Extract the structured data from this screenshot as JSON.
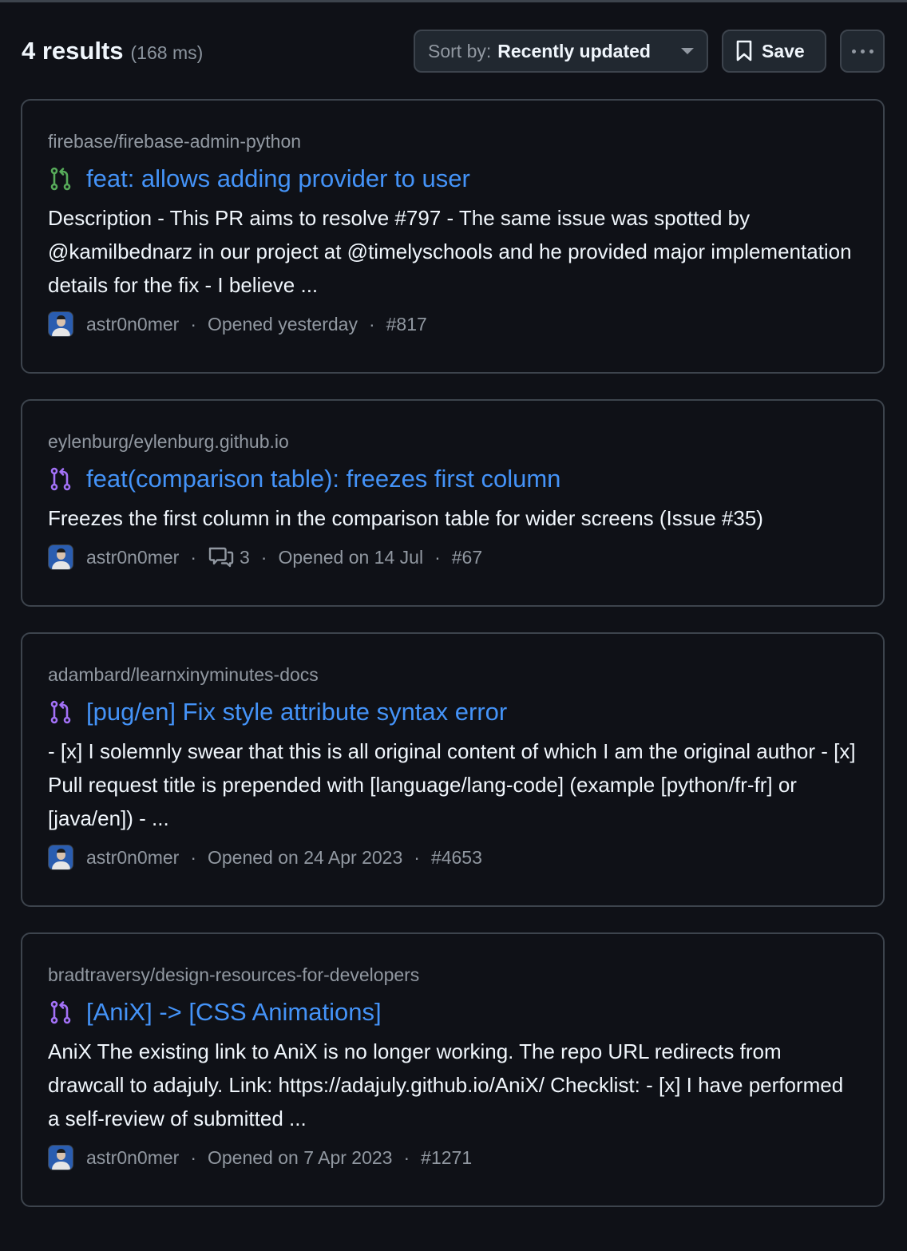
{
  "header": {
    "results_count": "4 results",
    "results_time": "(168 ms)",
    "sort_prefix": "Sort by:",
    "sort_value": "Recently updated",
    "save_label": "Save"
  },
  "colors": {
    "background": "#0f1117",
    "link": "#4493f8",
    "open_pr": "#57ab5a",
    "merged_pr": "#a371f7",
    "muted": "#9198a1"
  },
  "results": [
    {
      "repo": "firebase/firebase-admin-python",
      "status": "open",
      "icon": "git-pull-request-icon",
      "title": "feat: allows adding provider to user",
      "description": "Description - This PR aims to resolve #797 - The same issue was spotted by @kamilbednarz in our project at @timelyschools and he provided major implementation details for the fix - I believe ...",
      "author": "astr0n0mer",
      "comments": null,
      "opened": "Opened yesterday",
      "number": "#817"
    },
    {
      "repo": "eylenburg/eylenburg.github.io",
      "status": "merged",
      "icon": "git-pull-request-icon",
      "title": "feat(comparison table): freezes first column",
      "description": "Freezes the first column in the comparison table for wider screens (Issue #35)",
      "author": "astr0n0mer",
      "comments": "3",
      "opened": "Opened on 14 Jul",
      "number": "#67"
    },
    {
      "repo": "adambard/learnxinyminutes-docs",
      "status": "merged",
      "icon": "git-pull-request-icon",
      "title": "[pug/en] Fix style attribute syntax error",
      "description": "- [x] I solemnly swear that this is all original content of which I am the original author - [x] Pull request title is prepended with [language/lang-code] (example [python/fr-fr] or [java/en]) - ...",
      "author": "astr0n0mer",
      "comments": null,
      "opened": "Opened on 24 Apr 2023",
      "number": "#4653"
    },
    {
      "repo": "bradtraversy/design-resources-for-developers",
      "status": "merged",
      "icon": "git-pull-request-icon",
      "title": "[AniX] -> [CSS Animations]",
      "description": "AniX The existing link to AniX is no longer working. The repo URL redirects from drawcall to adajuly. Link: https://adajuly.github.io/AniX/ Checklist: - [x] I have performed a self-review of submitted ...",
      "author": "astr0n0mer",
      "comments": null,
      "opened": "Opened on 7 Apr 2023",
      "number": "#1271"
    }
  ]
}
